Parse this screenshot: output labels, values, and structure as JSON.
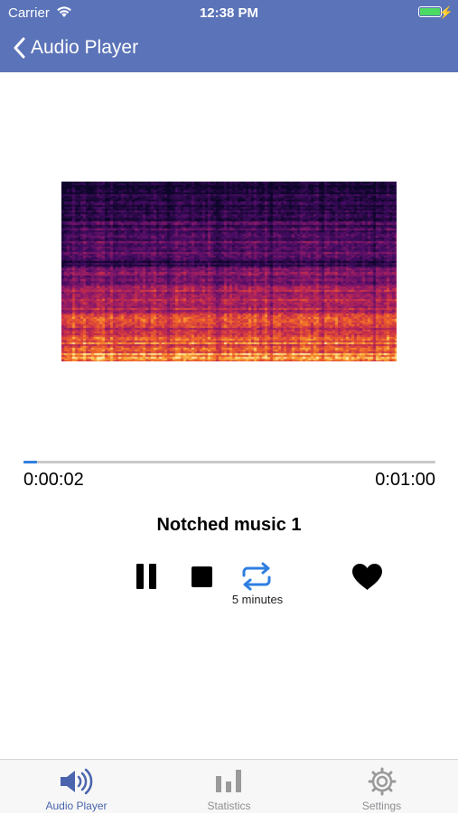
{
  "status_bar": {
    "carrier": "Carrier",
    "time": "12:38 PM",
    "battery_color": "#4cd964"
  },
  "nav": {
    "title": "Audio Player",
    "back_icon": "chevron-left-icon",
    "background": "#5b73b8"
  },
  "player": {
    "elapsed": "0:00:02",
    "total": "0:01:00",
    "progress": 0.033,
    "track_title": "Notched music 1",
    "repeat_caption": "5 minutes",
    "controls": [
      "pause-icon",
      "stop-icon",
      "repeat-icon",
      "heart-icon"
    ],
    "accent": "#2f7fe0"
  },
  "tabs": [
    {
      "label": "Audio Player",
      "icon": "speaker-icon",
      "active": true
    },
    {
      "label": "Statistics",
      "icon": "bar-chart-icon",
      "active": false
    },
    {
      "label": "Settings",
      "icon": "gear-icon",
      "active": false
    }
  ]
}
